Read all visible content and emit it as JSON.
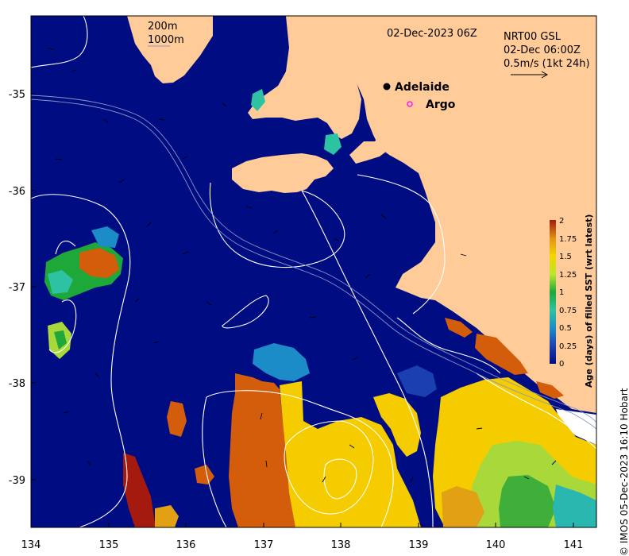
{
  "title": "02-Dec-2023 06Z",
  "product": {
    "line1": "NRT00 GSL",
    "line2": "02-Dec 06:00Z",
    "line3": "0.5m/s (1kt 24h)"
  },
  "isobath_legend": {
    "a": "200m",
    "b": "1000m"
  },
  "places": {
    "adelaide": "Adelaide",
    "argo": "Argo"
  },
  "x_ticks": [
    "134",
    "135",
    "136",
    "137",
    "138",
    "139",
    "140",
    "141"
  ],
  "y_ticks": [
    "-35",
    "-36",
    "-37",
    "-38",
    "-39"
  ],
  "colorbar": {
    "label": "Age (days) of filled SST (wrt latest)",
    "ticks": [
      "2",
      "1.75",
      "1.5",
      "1.25",
      "1",
      "0.75",
      "0.5",
      "0.25",
      "0"
    ]
  },
  "credit": "© IMOS 05-Dec-2023 16:10 Hobart",
  "colors": {
    "ocean": "#000c82",
    "land": "#ffcc99",
    "argo": "#ff00ff"
  }
}
